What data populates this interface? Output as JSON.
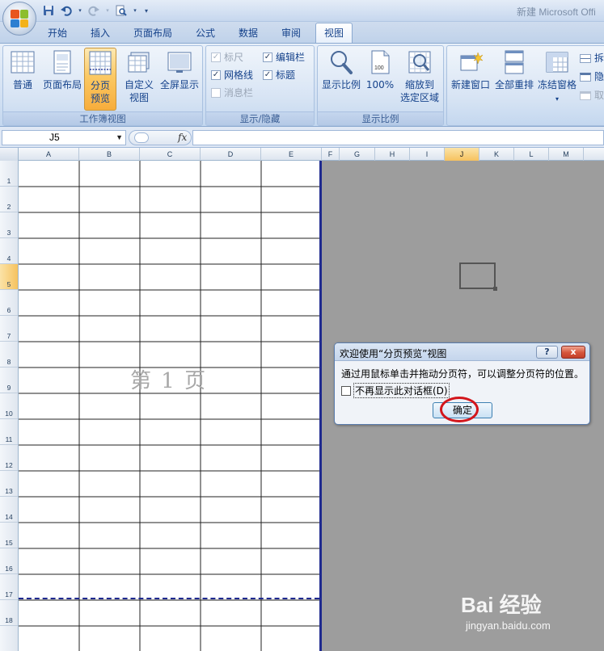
{
  "window": {
    "title": "新建 Microsoft Offi"
  },
  "tabs": [
    "开始",
    "插入",
    "页面布局",
    "公式",
    "数据",
    "审阅",
    "视图"
  ],
  "active_tab": "视图",
  "ribbon": {
    "workbook_views": {
      "label": "工作簿视图",
      "normal": "普通",
      "page_layout": "页面布局",
      "page_break_preview": [
        "分页",
        "预览"
      ],
      "custom_views": [
        "自定义",
        "视图"
      ],
      "full_screen": "全屏显示"
    },
    "show_hide": {
      "label": "显示/隐藏",
      "ruler": "标尺",
      "formula_bar": "编辑栏",
      "gridlines": "网格线",
      "headings": "标题",
      "message_bar": "消息栏"
    },
    "zoom": {
      "label": "显示比例",
      "zoom": "显示比例",
      "hundred": "100%",
      "zoom_selection": [
        "缩放到",
        "选定区域"
      ]
    },
    "window": {
      "new_window": "新建窗口",
      "arrange_all": "全部重排",
      "freeze_panes": "冻结窗格",
      "split": "拆",
      "hide": "隐",
      "unhide": "取"
    }
  },
  "formula_bar": {
    "name_box": "J5",
    "fx": "fx",
    "content": ""
  },
  "columns": [
    "A",
    "B",
    "C",
    "D",
    "E",
    "F",
    "G",
    "H",
    "I",
    "J",
    "K",
    "L",
    "M"
  ],
  "selected_column": "J",
  "rows": [
    "1",
    "2",
    "3",
    "4",
    "5",
    "6",
    "7",
    "8",
    "9",
    "10",
    "11",
    "12",
    "13",
    "14",
    "15",
    "16",
    "17",
    "18"
  ],
  "selected_row": "5",
  "page_watermark": "第 1 页",
  "dialog": {
    "title": "欢迎使用“分页预览”视图",
    "help": "?",
    "close": "x",
    "message": "通过用鼠标单击并拖动分页符，可以调整分页符的位置。",
    "checkbox_label": "不再显示此对话框(D)",
    "ok": "确定"
  },
  "colors": {
    "accent": "#1f2a8f",
    "highlight": "#d3161c"
  },
  "watermark": {
    "main": "Bai 经验",
    "sub": "jingyan.baidu.com"
  }
}
